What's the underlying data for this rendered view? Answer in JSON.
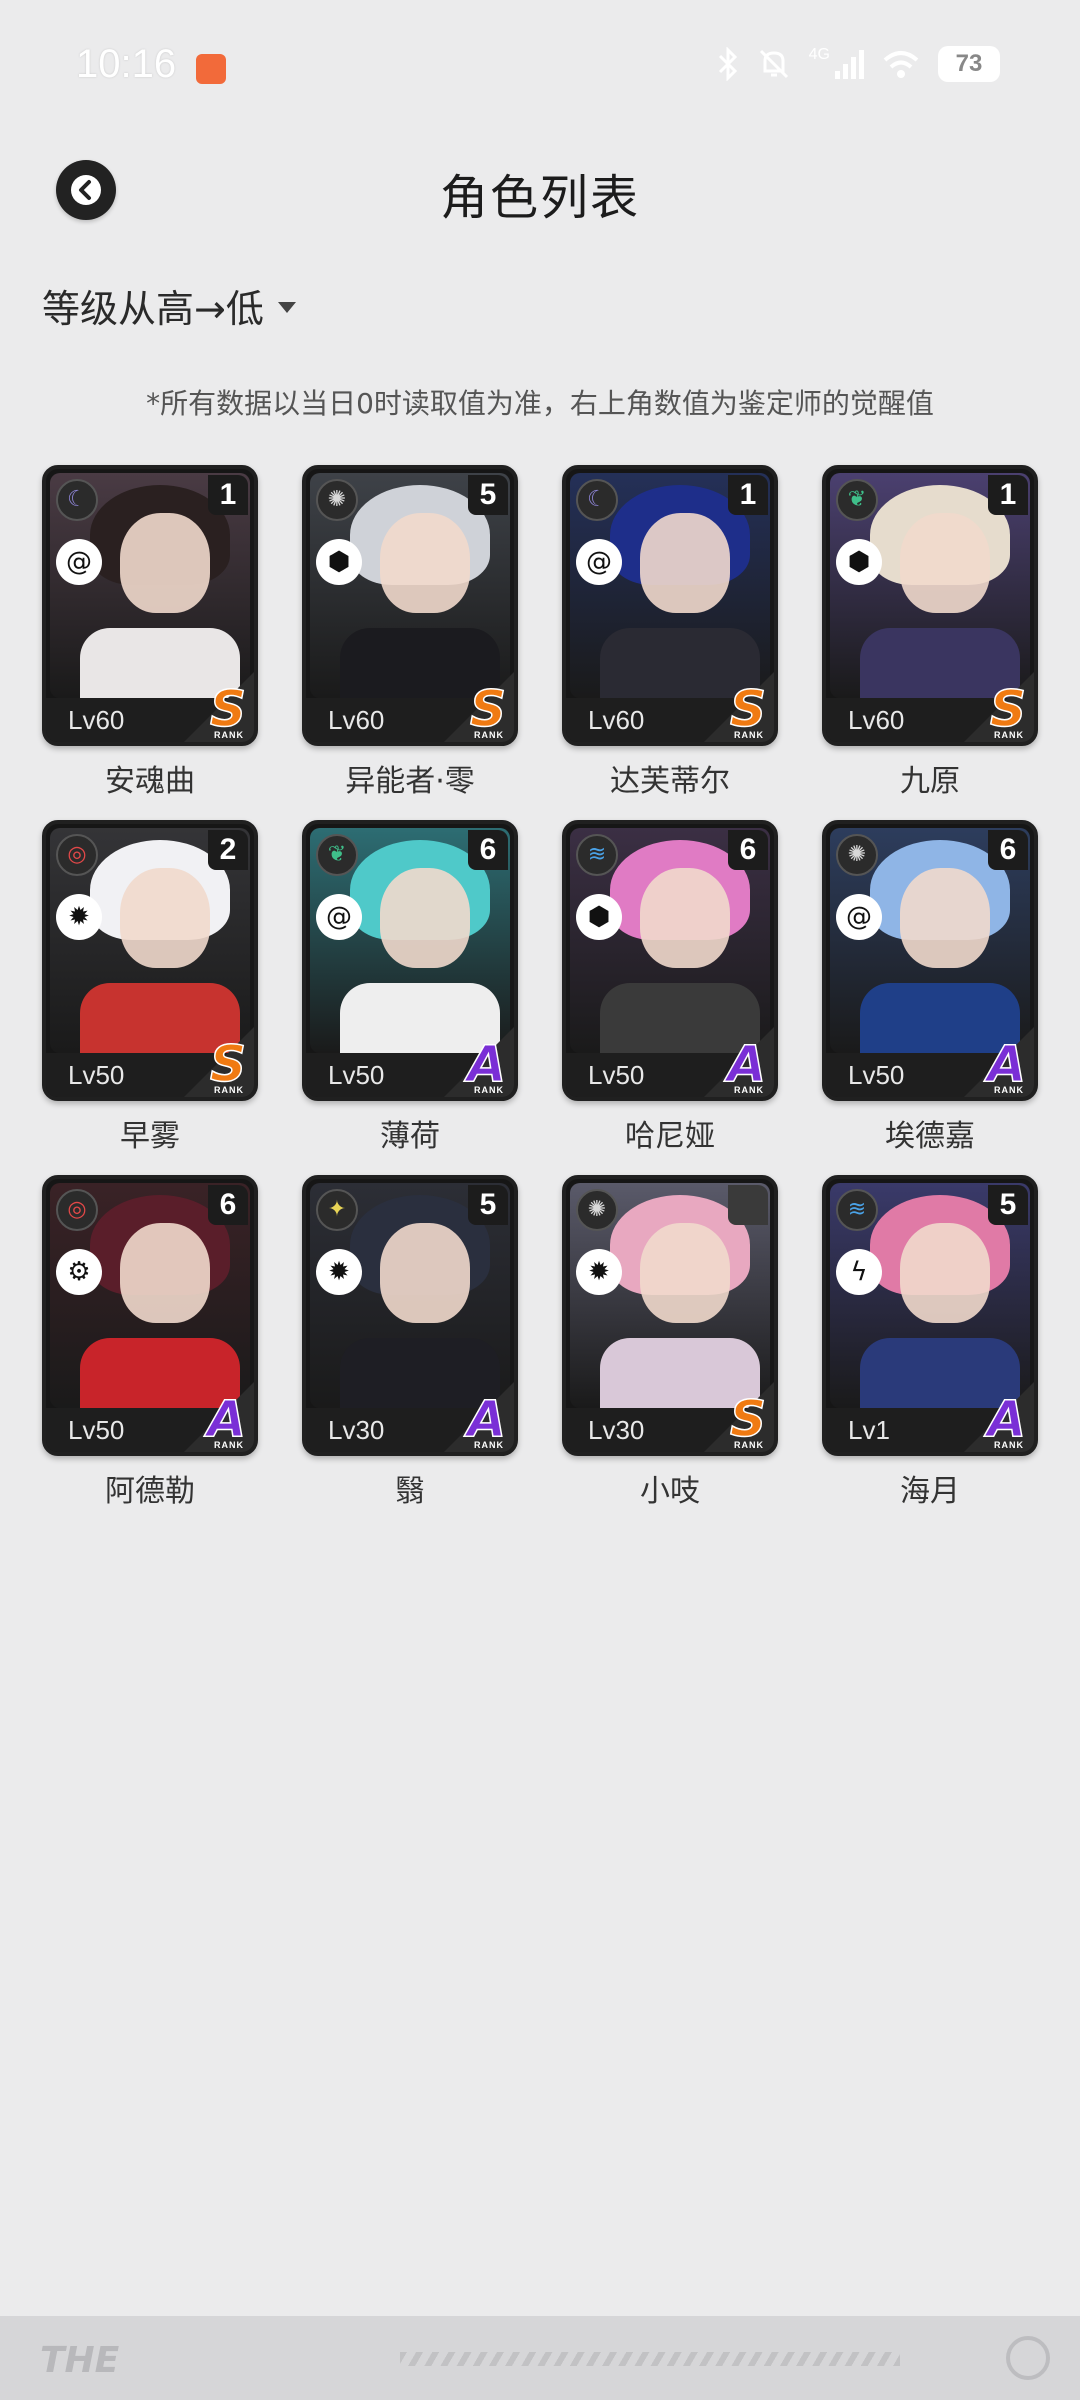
{
  "status_bar": {
    "time": "10:16",
    "battery": "73",
    "network": "4G"
  },
  "header": {
    "title": "角色列表"
  },
  "sort": {
    "label": "等级从高→低"
  },
  "note": "*所有数据以当日0时读取值为准，右上角数值为鉴定师的觉醒值",
  "rank_label": "RANK",
  "characters": [
    {
      "name": "安魂曲",
      "level": "Lv60",
      "awake": "1",
      "rank": "S",
      "attr_icon": "moon-icon",
      "attr_color": "#8f86d8",
      "type_icon": "spiral-icon",
      "hair": "#2a2020",
      "body": "#e9e6e6",
      "bg": "#4a3b44"
    },
    {
      "name": "异能者·零",
      "level": "Lv60",
      "awake": "5",
      "rank": "S",
      "attr_icon": "sun-icon",
      "attr_color": "#d8d8d8",
      "type_icon": "cube-icon",
      "hair": "#cfd2d8",
      "body": "#1b1b1f",
      "bg": "#3e4248"
    },
    {
      "name": "达芙蒂尔",
      "level": "Lv60",
      "awake": "1",
      "rank": "S",
      "attr_icon": "moon-icon",
      "attr_color": "#8f86d8",
      "type_icon": "spiral-icon",
      "hair": "#1e2e8a",
      "body": "#2a2a33",
      "bg": "#243058"
    },
    {
      "name": "九原",
      "level": "Lv60",
      "awake": "1",
      "rank": "S",
      "attr_icon": "leaf-icon",
      "attr_color": "#3fbf8a",
      "type_icon": "cube-icon",
      "hair": "#e6dccd",
      "body": "#3a3560",
      "bg": "#4b4070"
    },
    {
      "name": "早雾",
      "level": "Lv50",
      "awake": "2",
      "rank": "S",
      "attr_icon": "target-icon",
      "attr_color": "#e24848",
      "type_icon": "vortex-icon",
      "hair": "#f1f1f4",
      "body": "#c7332f",
      "bg": "#343437"
    },
    {
      "name": "薄荷",
      "level": "Lv50",
      "awake": "6",
      "rank": "A",
      "attr_icon": "leaf-icon",
      "attr_color": "#3fbf8a",
      "type_icon": "spiral-icon",
      "hair": "#4fc9c9",
      "body": "#eeeeee",
      "bg": "#2d6d73"
    },
    {
      "name": "哈尼娅",
      "level": "Lv50",
      "awake": "6",
      "rank": "A",
      "attr_icon": "wave-icon",
      "attr_color": "#4aa3e8",
      "type_icon": "cube-icon",
      "hair": "#e07bc4",
      "body": "#3a3a3a",
      "bg": "#3b2f44"
    },
    {
      "name": "埃德嘉",
      "level": "Lv50",
      "awake": "6",
      "rank": "A",
      "attr_icon": "sun-icon",
      "attr_color": "#d8d8d8",
      "type_icon": "spiral-icon",
      "hair": "#8fb5e6",
      "body": "#1f3f88",
      "bg": "#2d3d5d"
    },
    {
      "name": "阿德勒",
      "level": "Lv50",
      "awake": "6",
      "rank": "A",
      "attr_icon": "target-icon",
      "attr_color": "#e24848",
      "type_icon": "gear-icon",
      "hair": "#5a1e2a",
      "body": "#c8242a",
      "bg": "#3a2226"
    },
    {
      "name": "翳",
      "level": "Lv30",
      "awake": "5",
      "rank": "A",
      "attr_icon": "star-icon",
      "attr_color": "#e8d456",
      "type_icon": "vortex-icon",
      "hair": "#2a2f3e",
      "body": "#1e1e24",
      "bg": "#2c2e36"
    },
    {
      "name": "小吱",
      "level": "Lv30",
      "awake": "",
      "rank": "S",
      "attr_icon": "sun-icon",
      "attr_color": "#d8d8d8",
      "type_icon": "vortex-icon",
      "hair": "#e8a8c0",
      "body": "#d9c8d8",
      "bg": "#5a5a6a"
    },
    {
      "name": "海月",
      "level": "Lv1",
      "awake": "5",
      "rank": "A",
      "attr_icon": "wave-icon",
      "attr_color": "#4aa3e8",
      "type_icon": "bolt-icon",
      "hair": "#e07aa6",
      "body": "#2a3a7a",
      "bg": "#3a3a6a"
    }
  ],
  "bottom_bar": {
    "logo": "THE"
  }
}
